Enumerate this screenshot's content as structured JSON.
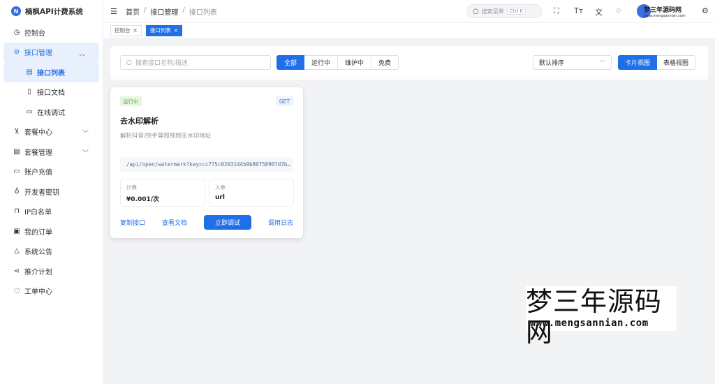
{
  "app": {
    "title": "楠枫API计费系统",
    "logo_letter": "N"
  },
  "sidebar": {
    "items": [
      {
        "label": "控制台"
      },
      {
        "label": "接口管理"
      },
      {
        "label": "接口列表"
      },
      {
        "label": "接口文档"
      },
      {
        "label": "在线调试"
      },
      {
        "label": "套餐中心"
      },
      {
        "label": "套餐管理"
      },
      {
        "label": "账户充值"
      },
      {
        "label": "开发者密钥"
      },
      {
        "label": "IP白名单"
      },
      {
        "label": "我的订单"
      },
      {
        "label": "系统公告"
      },
      {
        "label": "推介计划"
      },
      {
        "label": "工单中心"
      }
    ]
  },
  "header": {
    "breadcrumb": [
      "首页",
      "接口管理",
      "接口列表"
    ],
    "search_placeholder": "搜索菜单",
    "search_shortcut": "Ctrl K",
    "user_watermark": "梦三年源码网",
    "user_watermark_url": "www.mengsannian.com"
  },
  "tags": [
    {
      "label": "控制台"
    },
    {
      "label": "接口列表"
    }
  ],
  "toolbar": {
    "search_placeholder": "搜索接口名称/描述",
    "filters": [
      "全部",
      "运行中",
      "维护中",
      "免费"
    ],
    "sort_value": "默认排序",
    "views": [
      "卡片视图",
      "表格视图"
    ]
  },
  "card": {
    "status": "运行中",
    "method": "GET",
    "title": "去水印解析",
    "description": "解析抖音/快手等短视频无水印地址",
    "url": "/api/open/watermark?key=cc775c0203144b9b80758907d7b…",
    "price_label": "计费",
    "price_value": "¥0.001/次",
    "param_label": "入参",
    "param_value": "url",
    "actions": {
      "copy": "复制接口",
      "docs": "查看文档",
      "debug": "立即调试",
      "logs": "调用日志"
    }
  },
  "watermark": {
    "title": "梦三年源码网",
    "url": "www.mengsannian.com"
  },
  "colors": {
    "primary": "#1f6fe8",
    "success": "#52b043",
    "background": "#f2f3f5"
  }
}
